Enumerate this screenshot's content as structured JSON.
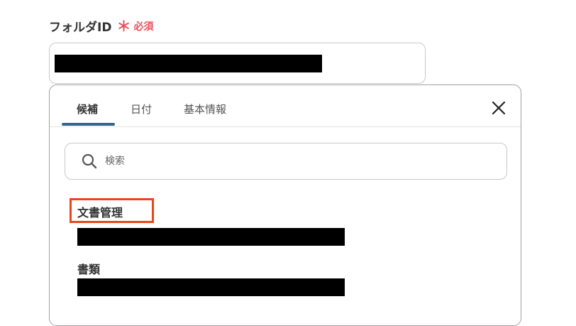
{
  "field": {
    "label": "フォルダID",
    "required_star": "＊",
    "required_text": "必須"
  },
  "dropdown": {
    "tabs": [
      {
        "label": "候補"
      },
      {
        "label": "日付"
      },
      {
        "label": "基本情報"
      }
    ],
    "active_tab": "候補",
    "search": {
      "placeholder": "検索",
      "value": ""
    },
    "options": [
      {
        "title": "文書管理"
      },
      {
        "title": "書類"
      }
    ]
  },
  "colors": {
    "required": "#e8525b",
    "tab_underline": "#2a6a86",
    "highlight_box": "#e8471a"
  }
}
